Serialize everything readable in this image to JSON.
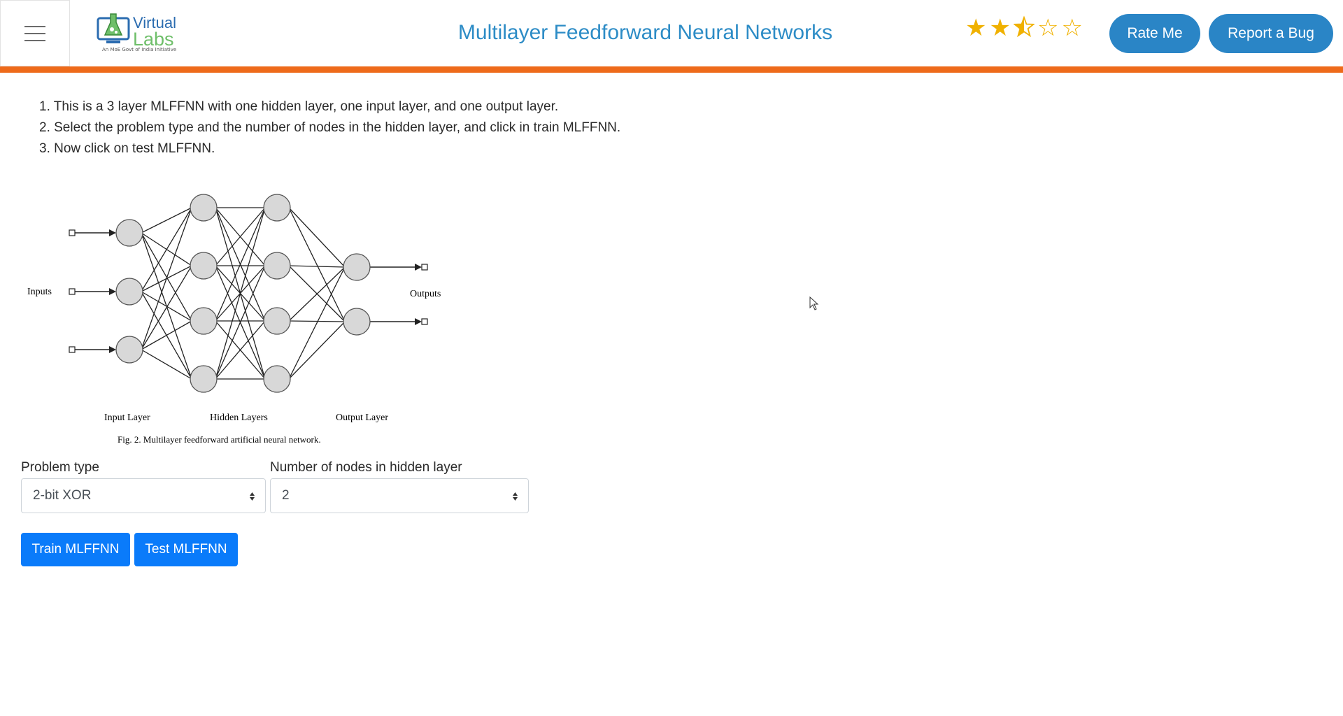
{
  "header": {
    "menu_icon": "hamburger-icon",
    "logo": {
      "line1": "Virtual",
      "line2": "Labs",
      "subtitle": "An MoE Govt of India Initiative"
    },
    "title": "Multilayer Feedforward Neural Networks",
    "rating": {
      "value": 2.5,
      "max": 5,
      "icon": "star-icon",
      "color": "#f0b100"
    },
    "rate_button": "Rate Me",
    "bug_button": "Report a Bug",
    "accent_color": "#2d8cc6",
    "bar_color": "#ee6a1a"
  },
  "instructions": [
    "1. This is a 3 layer MLFFNN with one hidden layer, one input layer, and one output layer.",
    "2. Select the problem type and the number of nodes in the hidden layer, and click in train MLFFNN.",
    "3. Now click on test MLFFNN."
  ],
  "figure": {
    "inputs_label": "Inputs",
    "outputs_label": "Outputs",
    "input_layer_label": "Input Layer",
    "hidden_layers_label": "Hidden Layers",
    "output_layer_label": "Output Layer",
    "caption": "Fig.  2.  Multilayer feedforward artificial neural network.",
    "layer_sizes": [
      3,
      4,
      4,
      2
    ]
  },
  "form": {
    "problem_type_label": "Problem type",
    "problem_type_value": "2-bit XOR",
    "hidden_nodes_label": "Number of nodes in hidden layer",
    "hidden_nodes_value": "2"
  },
  "actions": {
    "train": "Train MLFFNN",
    "test": "Test MLFFNN",
    "button_color": "#0a7bfa"
  }
}
